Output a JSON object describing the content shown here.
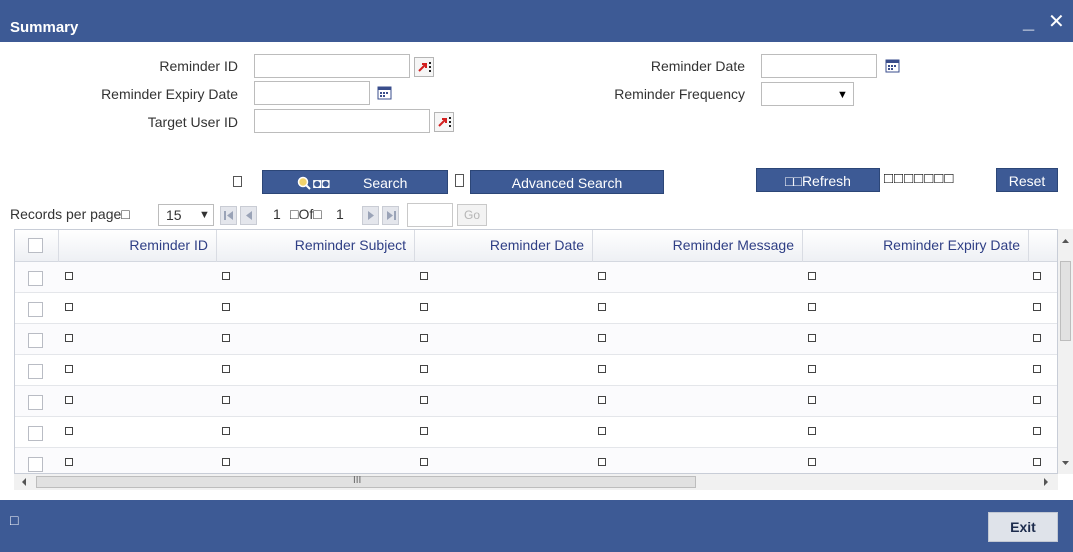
{
  "window": {
    "title": "Summary",
    "minimize_label": "_",
    "close_label": "✕"
  },
  "form": {
    "reminder_id_label": "Reminder ID",
    "reminder_id_value": "",
    "reminder_expiry_date_label": "Reminder Expiry Date",
    "reminder_expiry_date_value": "",
    "target_user_id_label": "Target User ID",
    "target_user_id_value": "",
    "reminder_date_label": "Reminder Date",
    "reminder_date_value": "",
    "reminder_frequency_label": "Reminder Frequency",
    "reminder_frequency_value": "",
    "caret": "▼"
  },
  "toolbar": {
    "search_label": "Search",
    "search_prefix": "◘◘",
    "advanced_search_label": "Advanced Search",
    "refresh_label": "□□Refresh",
    "reset_label": "Reset",
    "reset_prefix": "□□□□□□□"
  },
  "pager": {
    "records_per_page_label": "Records per page□",
    "records_per_page_value": "15",
    "current_page": "1",
    "of_label": "□Of□",
    "total_pages": "1",
    "go_label": "Go"
  },
  "grid": {
    "columns": [
      "Reminder ID",
      "Reminder Subject",
      "Reminder Date",
      "Reminder Message",
      "Reminder Expiry Date"
    ],
    "row_count": 7
  },
  "scroll": {
    "h_label": "III"
  },
  "footer": {
    "exit_label": "Exit",
    "status_text": "□"
  },
  "icons": [
    "lov-picker-icon",
    "calendar-icon",
    "search-icon",
    "dropdown-caret-icon",
    "first-page-icon",
    "prev-page-icon",
    "next-page-icon",
    "last-page-icon"
  ]
}
